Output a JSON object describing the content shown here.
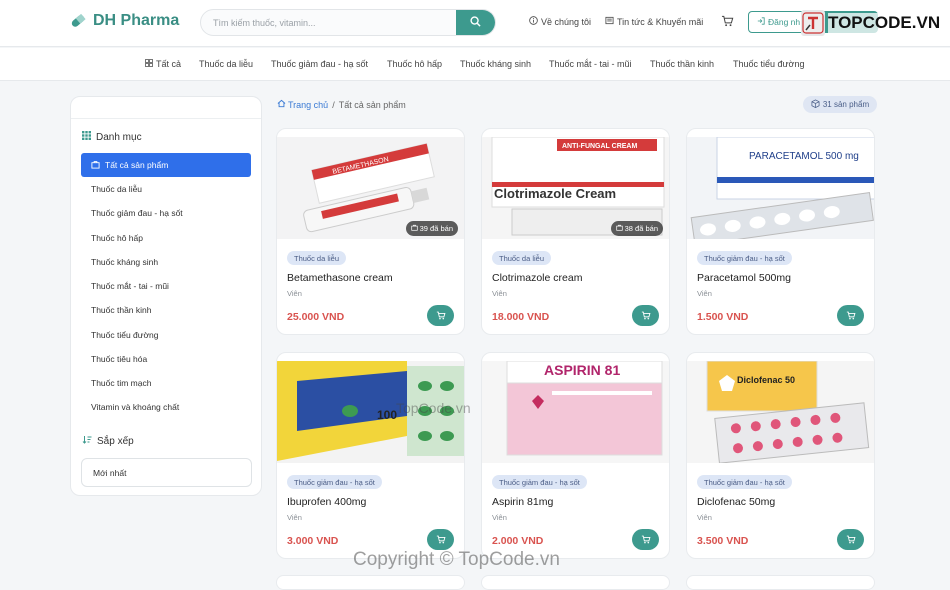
{
  "header": {
    "brand": "DH Pharma",
    "search_placeholder": "Tìm kiếm thuốc, vitamin...",
    "about_label": "Về chúng tôi",
    "news_label": "Tin tức & Khuyến mãi",
    "login_label": "Đăng nh",
    "brand_color": "#3d9a8e"
  },
  "watermark": {
    "logo_text": "TOPCODE.VN",
    "center_text": "TopCode.vn",
    "copyright_text": "Copyright © TopCode.vn"
  },
  "categories": [
    "Tất cả",
    "Thuốc da liễu",
    "Thuốc giảm đau - hạ sốt",
    "Thuốc hô hấp",
    "Thuốc kháng sinh",
    "Thuốc mắt - tai - mũi",
    "Thuốc thần kinh",
    "Thuốc tiểu đường"
  ],
  "sidebar": {
    "category_heading": "Danh mục",
    "items": [
      "Tất cả sản phẩm",
      "Thuốc da liễu",
      "Thuốc giảm đau - hạ sốt",
      "Thuốc hô hấp",
      "Thuốc kháng sinh",
      "Thuốc mắt - tai - mũi",
      "Thuốc thần kinh",
      "Thuốc tiểu đường",
      "Thuốc tiêu hóa",
      "Thuốc tim mạch",
      "Vitamin và khoáng chất"
    ],
    "sort_heading": "Sắp xếp",
    "sort_value": "Mới nhất"
  },
  "breadcrumb": {
    "home": "Trang chủ",
    "separator": "/",
    "current": "Tất cả sản phẩm"
  },
  "product_count": "31 sản phẩm",
  "products": [
    {
      "tag": "Thuốc da liễu",
      "name": "Betamethasone cream",
      "unit": "Viên",
      "price": "25.000 VND",
      "sold": "39 đã bán",
      "box_text": "BETAMETHASON"
    },
    {
      "tag": "Thuốc da liễu",
      "name": "Clotrimazole cream",
      "unit": "Viên",
      "price": "18.000 VND",
      "sold": "38 đã bán",
      "box_text": "Clotrimazole Cream",
      "box_sub": "ANTI-FUNGAL CREAM"
    },
    {
      "tag": "Thuốc giảm đau - hạ sốt",
      "name": "Paracetamol 500mg",
      "unit": "Viên",
      "price": "1.500 VND",
      "box_text": "PARACETAMOL 500 mg"
    },
    {
      "tag": "Thuốc giảm đau - hạ sốt",
      "name": "Ibuprofen 400mg",
      "unit": "Viên",
      "price": "3.000 VND",
      "box_text": "100"
    },
    {
      "tag": "Thuốc giảm đau - hạ sốt",
      "name": "Aspirin 81mg",
      "unit": "Viên",
      "price": "2.000 VND",
      "box_text": "ASPIRIN 81"
    },
    {
      "tag": "Thuốc giảm đau - hạ sốt",
      "name": "Diclofenac 50mg",
      "unit": "Viên",
      "price": "3.500 VND",
      "box_text": "Diclofenac 50"
    }
  ]
}
